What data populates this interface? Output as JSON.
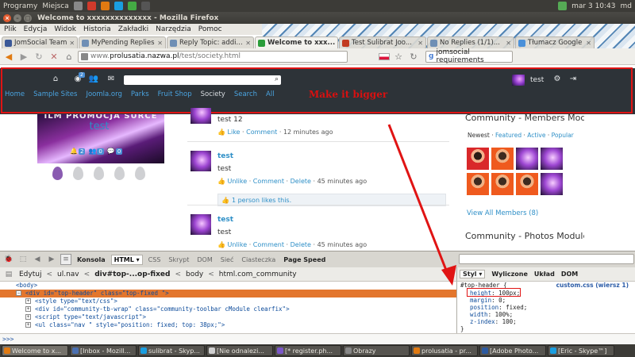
{
  "ubuntu_panel": {
    "apps_menu": "Programy",
    "places_menu": "Miejsca",
    "clock": "mar 3 10:43",
    "user": "md"
  },
  "window": {
    "title": "Welcome to xxxxxxxxxxxxxx - Mozilla Firefox"
  },
  "menubar": {
    "items": [
      "Plik",
      "Edycja",
      "Widok",
      "Historia",
      "Zakładki",
      "Narzędzia",
      "Pomoc"
    ]
  },
  "tabs": [
    {
      "label": "JomSocial Team",
      "color": "#3b5998"
    },
    {
      "label": "MyPending Replies",
      "color": "#6f8fb5"
    },
    {
      "label": "Reply Topic: addi...",
      "color": "#6f8fb5"
    },
    {
      "label": "Welcome to xxx...",
      "color": "#2a9d3a",
      "active": true
    },
    {
      "label": "Test Sulibrat Joo...",
      "color": "#c23b22"
    },
    {
      "label": "No Replies (1/1)...",
      "color": "#6f8fb5"
    },
    {
      "label": "Tłumacz Google",
      "color": "#4a90d9"
    }
  ],
  "urlbar": {
    "prefix": "www.",
    "host": "prolusatia.nazwa.pl",
    "path": "/test/society.html",
    "search_value": "jomsocial requirements"
  },
  "site": {
    "toolbar": {
      "notif_count": "2",
      "user_name": "test"
    },
    "subnav": [
      "Home",
      "Sample Sites",
      "Joomla.org",
      "Parks",
      "Fruit Shop",
      "Society",
      "Search",
      "All"
    ],
    "subnav_current": "Society",
    "profile": {
      "banner_text": "ILM PROMOCJA SURCE",
      "name": "test",
      "friends": "2",
      "groups": "0",
      "messages": "0"
    },
    "posts": [
      {
        "name": "",
        "text": "test 12",
        "actions": [
          "Like",
          "Comment"
        ],
        "time": "12 minutes ago"
      },
      {
        "name": "test",
        "text": "test",
        "actions": [
          "Unlike",
          "Comment",
          "Delete"
        ],
        "time": "45 minutes ago",
        "likes": "1 person likes this."
      },
      {
        "name": "test",
        "text": "test",
        "actions": [
          "Unlike",
          "Comment",
          "Delete"
        ],
        "time": "45 minutes ago"
      }
    ],
    "sidebar": {
      "members_title": "Community - Members Module",
      "tabs_prefix": "Newest",
      "tab_links": [
        "Featured",
        "Active",
        "Popular"
      ],
      "view_all": "View All Members (8)",
      "photos_title": "Community - Photos Module"
    },
    "annotation": "Make it bigger"
  },
  "firebug": {
    "toolbar": [
      "Konsola",
      "HTML",
      "CSS",
      "Skrypt",
      "DOM",
      "Sieć",
      "Ciasteczka",
      "Page Speed"
    ],
    "toolbar_active": "HTML",
    "edit_button": "Edytuj",
    "breadcrumbs": [
      "ul.nav",
      "div#top-...op-fixed",
      "body",
      "html.com_community"
    ],
    "breadcrumb_selected": "div#top-...op-fixed",
    "html_lines": [
      {
        "text": "<body>",
        "indent": 0
      },
      {
        "text": "<div id=\"top-header\" class=\"top-fixed \">",
        "indent": 1,
        "selected": true
      },
      {
        "text": "<style type=\"text/css\">",
        "indent": 2
      },
      {
        "text": "<div id=\"community-tb-wrap\" class=\"community-toolbar cModule clearfix\">",
        "indent": 2
      },
      {
        "text": "<script type=\"text/javascript\">",
        "indent": 2
      },
      {
        "text": "<ul class=\"nav \" style=\"position: fixed; top: 38px;\">",
        "indent": 2
      }
    ],
    "side_tabs": [
      "Styl",
      "Wyliczone",
      "Układ",
      "DOM"
    ],
    "side_tab_active": "Styl",
    "css": {
      "selector": "#top-header {",
      "source": "custom.css (wiersz 1)",
      "rules": [
        {
          "prop": "height",
          "value": "100px;"
        },
        {
          "prop": "margin",
          "value": "0;"
        },
        {
          "prop": "position",
          "value": "fixed;"
        },
        {
          "prop": "width",
          "value": "100%;"
        },
        {
          "prop": "z-index",
          "value": "100;"
        }
      ],
      "close": "}"
    },
    "console_prompt": ">>>"
  },
  "taskbar": [
    {
      "label": "Welcome to x...",
      "color": "#e07a12",
      "active": true
    },
    {
      "label": "[Inbox - Mozill...",
      "color": "#4a6fb0"
    },
    {
      "label": "sulibrat - Skyp...",
      "color": "#1a9ee0"
    },
    {
      "label": "[Nie odnalezi...",
      "color": "#cfcfcf"
    },
    {
      "label": "[* register.ph...",
      "color": "#7b57c8"
    },
    {
      "label": "Obrazy",
      "color": "#888888"
    },
    {
      "label": "prolusatia - pr...",
      "color": "#e07a12"
    },
    {
      "label": "[Adobe Photo...",
      "color": "#2c5aa0"
    },
    {
      "label": "[Eric - Skype™]",
      "color": "#1a9ee0"
    }
  ]
}
